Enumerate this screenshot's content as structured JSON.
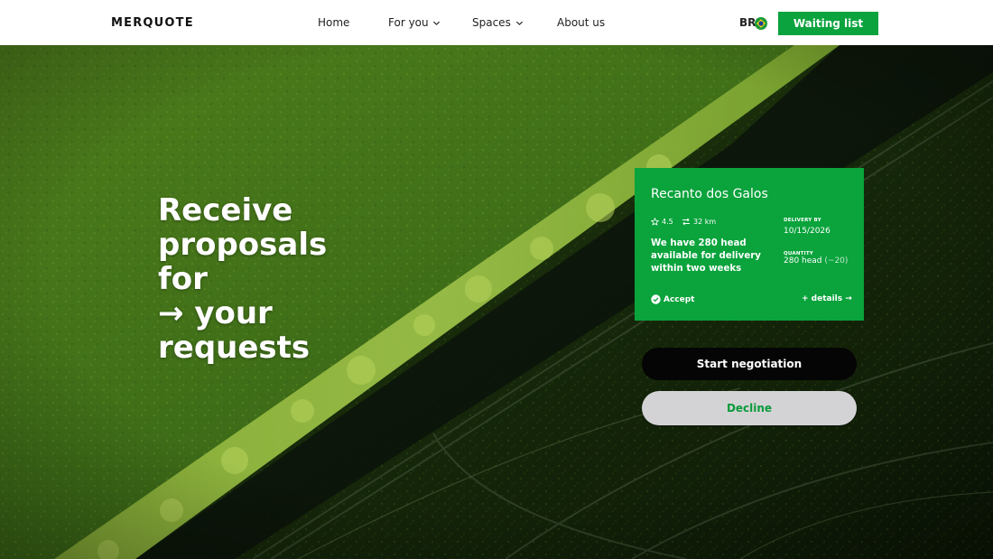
{
  "brand": {
    "logo": "MERQUOTE"
  },
  "nav": {
    "items": [
      {
        "label": "Home",
        "has_dropdown": false
      },
      {
        "label": "For you",
        "has_dropdown": true
      },
      {
        "label": "Spaces",
        "has_dropdown": true
      },
      {
        "label": "About us",
        "has_dropdown": false
      }
    ],
    "language": "BR",
    "waiting_list_label": "Waiting list"
  },
  "hero": {
    "headline_lines": [
      "Receive",
      "proposals",
      "for",
      "→ your",
      "requests"
    ]
  },
  "card": {
    "title": "Recanto dos Galos",
    "rating": "4.5",
    "distance": "32 km",
    "description": "We have 280 head available for delivery within two weeks",
    "delivery_label": "DELIVERY BY",
    "delivery_date": "10/15/2026",
    "quantity_label": "QUANTITY",
    "quantity_value": "280 head",
    "quantity_note": "(~20)",
    "accept_label": "Accept",
    "details_label": "+ details →"
  },
  "actions": {
    "negotiate_label": "Start negotiation",
    "decline_label": "Decline"
  },
  "colors": {
    "accent_green": "#0ba33e",
    "decline_bg": "#d3d3d5",
    "negotiate_bg": "#050505"
  },
  "icons": {
    "rating": "star-icon",
    "distance": "route-icon",
    "accept": "check-circle-icon",
    "dropdown": "chevron-down-icon",
    "flag": "brazil-flag-icon"
  }
}
